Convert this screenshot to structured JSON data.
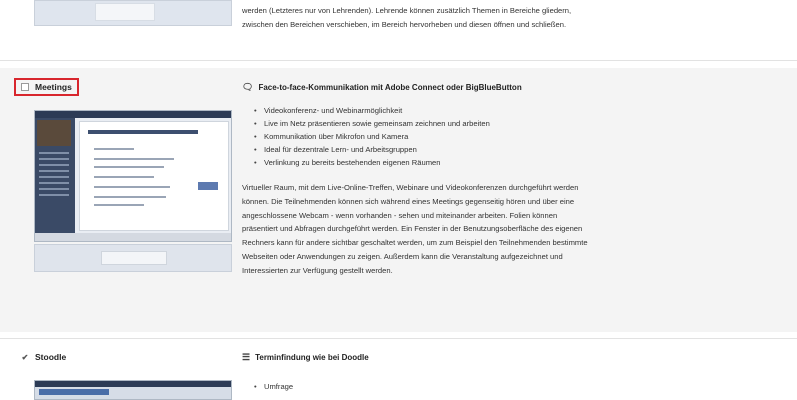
{
  "top_section": {
    "description_lines": [
      "werden (Letzteres nur von Lehrenden). Lehrende können zusätzlich Themen in Bereiche gliedern,",
      "zwischen den Bereichen verschieben, im Bereich hervorheben und diesen öffnen und schließen."
    ]
  },
  "meetings": {
    "title": "Meetings",
    "heading": "Face-to-face-Kommunikation mit Adobe Connect oder BigBlueButton",
    "heading_icon": "chat-bubble-icon",
    "features": [
      "Videokonferenz- und Webinarmöglichkeit",
      "Live im Netz präsentieren sowie gemeinsam zeichnen und arbeiten",
      "Kommunikation über Mikrofon und Kamera",
      "Ideal für dezentrale Lern- und Arbeitsgruppen",
      "Verlinkung zu bereits bestehenden eigenen Räumen"
    ],
    "description_lines": [
      "Virtueller Raum, mit dem Live-Online-Treffen, Webinare und Videokonferenzen durchgeführt werden",
      "können. Die Teilnehmenden können sich während eines Meetings gegenseitig hören und über eine",
      "angeschlossene Webcam - wenn vorhanden - sehen und miteinander arbeiten. Folien können",
      "präsentiert und Abfragen durchgeführt werden. Ein Fenster in der Benutzungsoberfläche des eigenen",
      "Rechners kann für andere sichtbar geschaltet werden, um zum Beispiel den Teilnehmenden bestimmte",
      "Webseiten oder Anwendungen zu zeigen. Außerdem kann die Veranstaltung aufgezeichnet und",
      "Interessierten zur Verfügung gestellt werden."
    ],
    "highlight_color": "#d8262d"
  },
  "stoodle": {
    "title": "Stoodle",
    "heading": "Terminfindung wie bei Doodle",
    "heading_icon": "list-icon",
    "features": [
      "Umfrage"
    ]
  }
}
